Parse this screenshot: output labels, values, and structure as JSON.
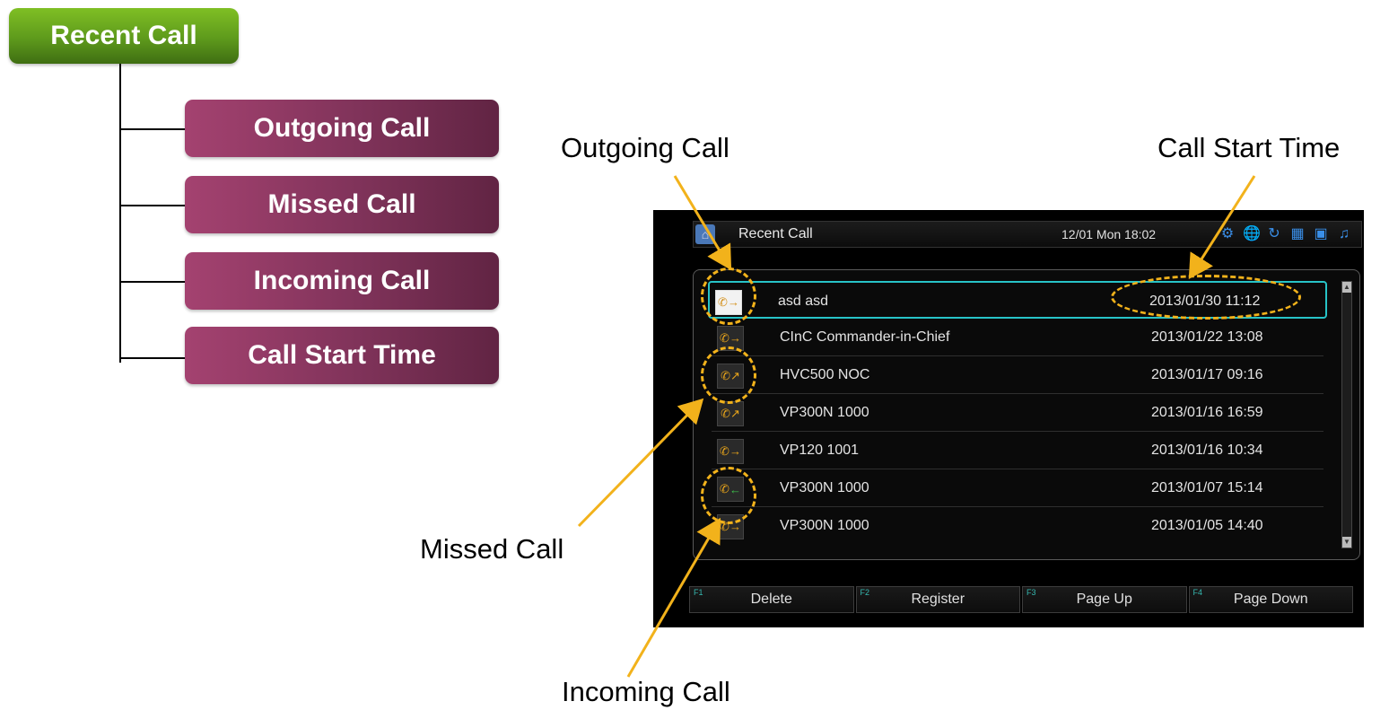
{
  "tree": {
    "root": "Recent Call",
    "leaves": [
      "Outgoing Call",
      "Missed Call",
      "Incoming Call",
      "Call Start Time"
    ]
  },
  "callouts": {
    "outgoing": "Outgoing Call",
    "call_start_time": "Call Start Time",
    "missed": "Missed Call",
    "incoming": "Incoming Call"
  },
  "screen": {
    "title": "Recent Call",
    "clock": "12/01 Mon 18:02",
    "status_icons": [
      "settings-icon",
      "network-icon",
      "sync-icon",
      "calendar-icon",
      "camera-icon",
      "speaker-icon"
    ],
    "calls": [
      {
        "name": "asd asd",
        "time": "2013/01/30 11:12",
        "type": "outgoing",
        "icon": "phone-outgoing-icon"
      },
      {
        "name": "CInC Commander-in-Chief",
        "time": "2013/01/22 13:08",
        "type": "outgoing",
        "icon": "phone-outgoing-icon"
      },
      {
        "name": "HVC500 NOC",
        "time": "2013/01/17 09:16",
        "type": "missed",
        "icon": "phone-missed-icon"
      },
      {
        "name": "VP300N 1000",
        "time": "2013/01/16 16:59",
        "type": "missed",
        "icon": "phone-missed-icon"
      },
      {
        "name": "VP120 1001",
        "time": "2013/01/16 10:34",
        "type": "outgoing",
        "icon": "phone-outgoing-icon"
      },
      {
        "name": "VP300N 1000",
        "time": "2013/01/07 15:14",
        "type": "incoming",
        "icon": "phone-incoming-icon"
      },
      {
        "name": "VP300N 1000",
        "time": "2013/01/05 14:40",
        "type": "outgoing",
        "icon": "phone-outgoing-icon"
      }
    ],
    "function_keys": [
      {
        "key": "F1",
        "label": "Delete"
      },
      {
        "key": "F2",
        "label": "Register"
      },
      {
        "key": "F3",
        "label": "Page Up"
      },
      {
        "key": "F4",
        "label": "Page Down"
      }
    ]
  },
  "colors": {
    "root_green": "#6aa81f",
    "leaf_maroon": "#8a3762",
    "highlight_ring": "#f2b21b",
    "selection_cyan": "#27c3c7"
  }
}
